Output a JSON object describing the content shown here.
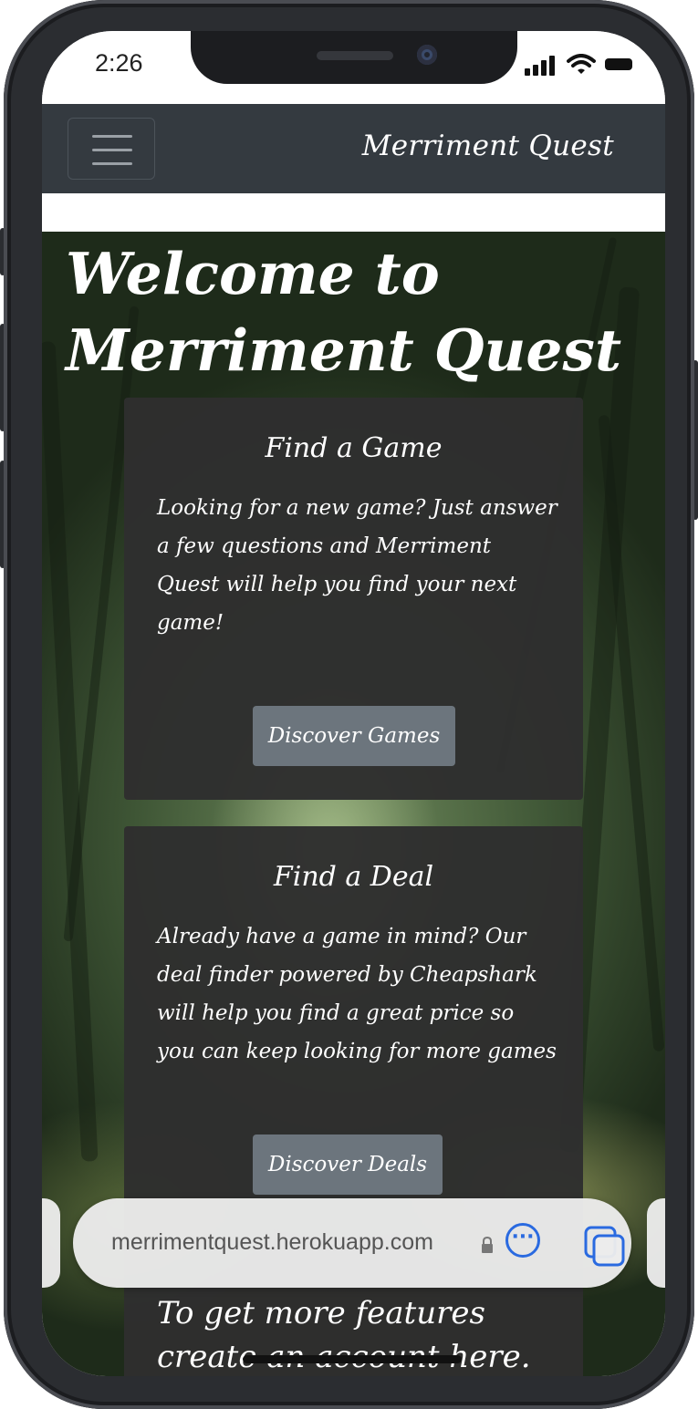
{
  "status_bar": {
    "time": "2:26"
  },
  "navbar": {
    "brand": "Merriment Quest",
    "toggler_icon": "hamburger-icon"
  },
  "hero": {
    "title": "Welcome to Merriment Quest"
  },
  "cards": [
    {
      "title": "Find a Game",
      "text": "Looking for a new game? Just answer a few questions and Merriment Quest will help you find your next game!",
      "button": "Discover Games"
    },
    {
      "title": "Find a Deal",
      "text": "Already have a game in mind? Our deal finder powered by Cheapshark will help you find a great price so you can keep looking for more games",
      "button": "Discover Deals"
    }
  ],
  "cta": {
    "text": "To get more features create an account here."
  },
  "browser": {
    "url": "merrimentquest.herokuapp.com",
    "icons": [
      "lock-icon",
      "more-icon",
      "tabs-icon"
    ],
    "accent": "#2a6ae0"
  },
  "colors": {
    "navbar": "#343a40",
    "card": "#2e2e2e",
    "button": "#6c757d"
  }
}
